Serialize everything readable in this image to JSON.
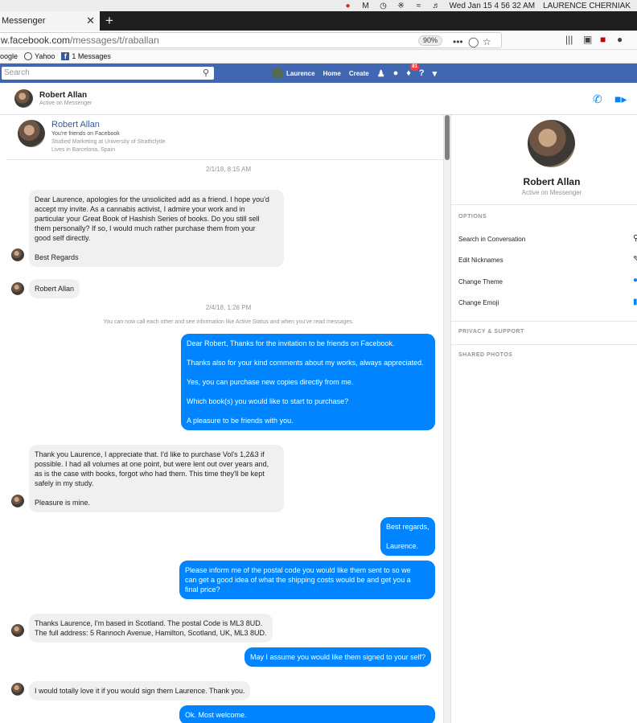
{
  "menubar": {
    "clock": "Wed Jan 15  4 56 32 AM",
    "user": "LAURENCE CHERNIAK"
  },
  "browser": {
    "tab_title": "Messenger",
    "url_prefix": "w.facebook.com",
    "url_path": "/messages/t/raballan",
    "zoom": "90%",
    "bookmarks": [
      "oogle",
      "Yahoo",
      "1 Messages"
    ]
  },
  "fb": {
    "search_placeholder": "Search",
    "nav_name": "Laurence",
    "nav_home": "Home",
    "nav_create": "Create",
    "notif_count": "81"
  },
  "header": {
    "name": "Robert Allan",
    "status": "Active on Messenger"
  },
  "profile_card": {
    "name": "Robert Allan",
    "friends": "You're friends on Facebook",
    "studied": "Studied Marketing at University of Strathclyde",
    "lives": "Lives in Barcelona, Spain"
  },
  "timestamps": [
    "2/1/18, 8:15 AM",
    "2/4/18, 1:26 PM"
  ],
  "system_note": "You can now call each other and see information like Active Status and when you've read messages.",
  "messages": [
    {
      "dir": "in",
      "lines": [
        "Dear Laurence, apologies for the unsolicited add as a friend.  I hope you'd",
        "accept my invite.  As a cannabis activist, I admire your work and in",
        "particular your Great Book of Hashish Series of books.  Do you still sell",
        "them personally?  If so, I would much rather purchase them from your",
        "good self directly.",
        "",
        "Best Regards"
      ]
    },
    {
      "dir": "in",
      "lines": [
        "Robert Allan"
      ]
    },
    {
      "dir": "out",
      "lines": [
        "Dear Robert, Thanks for the invitation to be friends on Facebook.",
        "",
        "Thanks also for your kind comments about my works, always appreciated.",
        "",
        "Yes, you can purchase new copies directly from me.",
        "",
        "Which book(s) you would like to start to purchase?",
        "",
        "A pleasure to be friends with you."
      ]
    },
    {
      "dir": "in",
      "lines": [
        "Thank you Laurence, I appreciate that.  I'd like to purchase Vol's 1,2&3 if",
        "possible.  I had all volumes at one point, but were lent out over years and,",
        "as is the case with books, forgot who had them.  This time they'll be kept",
        "safely in my study.",
        "",
        "Pleasure is mine."
      ]
    },
    {
      "dir": "out",
      "lines": [
        "Best regards,",
        "",
        "Laurence."
      ]
    },
    {
      "dir": "out",
      "lines": [
        "Please inform me of the postal code you would like them sent to so we",
        "can get a good idea of what the shipping costs would be and get you a",
        "final price?"
      ]
    },
    {
      "dir": "in",
      "lines": [
        "Thanks Laurence, I'm based in Scotland.  The postal Code is ML3 8UD.",
        "The full address: 5 Rannoch Avenue, Hamilton, Scotland, UK, ML3 8UD."
      ]
    },
    {
      "dir": "out",
      "lines": [
        "May I assume you would like them signed to your self?"
      ]
    },
    {
      "dir": "in",
      "lines": [
        "I would totally love it if you would sign them Laurence.  Thank you."
      ]
    },
    {
      "dir": "out",
      "lines": [
        "Ok. Most welcome."
      ]
    }
  ],
  "info": {
    "name": "Robert Allan",
    "status": "Active on Messenger",
    "options_title": "OPTIONS",
    "options": [
      "Search in Conversation",
      "Edit Nicknames",
      "Change Theme",
      "Change Emoji"
    ],
    "privacy_title": "PRIVACY & SUPPORT",
    "photos_title": "SHARED PHOTOS"
  },
  "colors": {
    "fb_blue": "#4267b2",
    "messenger_blue": "#0084ff",
    "incoming_bubble": "#f1f0f0"
  }
}
